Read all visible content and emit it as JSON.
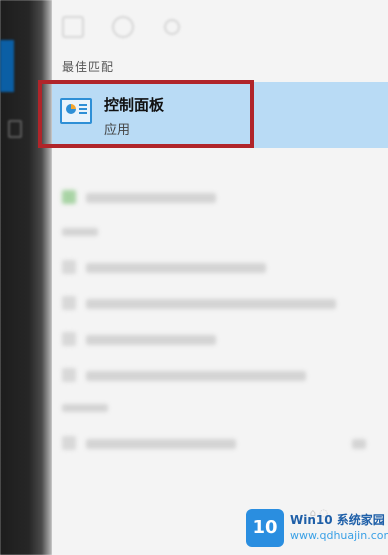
{
  "search_results": {
    "best_match_header": "最佳匹配",
    "best_match": {
      "title": "控制面板",
      "subtitle": "应用",
      "icon": "control-panel-icon"
    }
  },
  "watermark": {
    "logo_text": "10",
    "title": "Win10 系统家园",
    "site": "www.qdhuajin.com"
  },
  "colors": {
    "selection_bg": "#b9dbf5",
    "highlight_border": "#b0252a",
    "left_rail": "#1d1d1d",
    "accent": "#0b5fa5"
  }
}
